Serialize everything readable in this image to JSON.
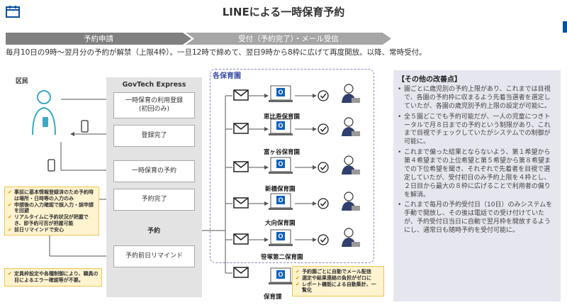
{
  "header": {
    "title": "LINEによる一時保育予約"
  },
  "process": {
    "steps": [
      "予約申請",
      "受付（予約完了）・メール受信"
    ],
    "description": "毎月10日の9時～翌月分の予約が解禁（上限4枠）。一旦12時で締めて、翌日9時から8枠に広げて再度開放。以降、常時受付。"
  },
  "resident": {
    "label": "区民"
  },
  "govtech": {
    "title": "GovTech Express",
    "steps": [
      "一時保育の利用登録\n(初回のみ)",
      "登録完了",
      "一時保育の予約",
      "予約完了",
      "予約",
      "予約前日リマインド"
    ]
  },
  "nurseries": {
    "title": "各保育園",
    "names": [
      "恵比寿保育園",
      "富ヶ谷保育園",
      "新橋保育園",
      "大向保育園",
      "笹塚第二保育園"
    ],
    "office": "保育課"
  },
  "notes": {
    "resident_benefits": [
      "事前に基本情報登録済のため予約時は場所・日時等の入力のみ",
      "申請後の入力確認で誤入力・誤申請を回避",
      "リアルタイムに予約状況が把握でき、即予約可否が把握可能",
      "前日リマインドで安心"
    ],
    "admin_benefits": [
      "定員枠設定や各種制御により、職員の目によるエラー確認等が不要。"
    ],
    "nursery_benefits": [
      "予約園ごとに自動でメール配信",
      "選定や結果連絡の負担がゼロに",
      "レポート機能による自動集計、一覧化"
    ]
  },
  "improvements": {
    "title": "【その他の改善点】",
    "items": [
      "園ごとに歳児別の予約上限があり、これまでは目視で、各園の予約枠に収まるよう先着当選者を選定していたが、各園の歳児別予約上限の設定が可能に。",
      "全５園どこでも予約可能だが、一人の児童につきトータルで月８日までの予約という制限があり、これまで目視でチェックしていたがシステムでの制御が可能に。",
      "これまで偏った結果とならないよう、第１希望から第４希望までの上位希望と第５希望から第８希望までの下位希望を聞き、それぞれで先着者を目視で選定していたが、受付初日のみ予約上限を４枠とし、２日目から最大の８枠に広げることで利用者の偏りを解消。",
      "これまで毎月の予約受付日（10日）のみシステムを手動で開放し、その後は電話での受け付けていたが、予約受付日当日に自動で翌月枠を開放するようにし、通常日も随時予約を受付可能に。"
    ]
  },
  "colors": {
    "accent": "#0a4fa0",
    "outlook": "#0f62bd",
    "check": "#2e2e2e",
    "person": "#3aa9c4"
  }
}
